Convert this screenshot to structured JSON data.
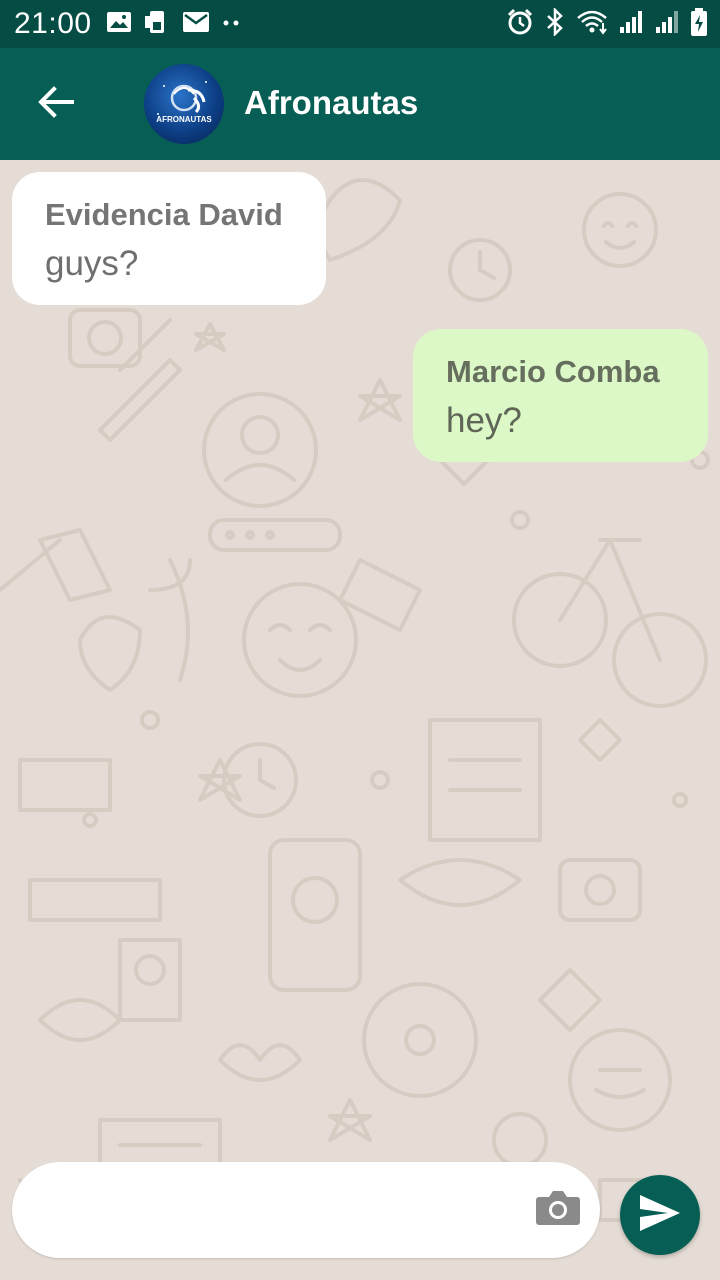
{
  "status_bar": {
    "time": "21:00",
    "left_icons": [
      "image-icon",
      "sim-card-icon",
      "mail-icon",
      "more-dots-icon"
    ],
    "right_icons": [
      "alarm-icon",
      "bluetooth-icon",
      "wifi-icon",
      "signal-icon",
      "signal-icon",
      "battery-charging-icon"
    ]
  },
  "header": {
    "contact_name": "Afronautas",
    "avatar_text": "AFRONAUTAS"
  },
  "messages": [
    {
      "sender": "Evidencia David",
      "text": "guys?",
      "direction": "incoming"
    },
    {
      "sender": "Marcio Comba",
      "text": "hey?",
      "direction": "outgoing"
    }
  ],
  "composer": {
    "input_value": "",
    "input_placeholder": ""
  },
  "colors": {
    "status_bar": "#054d44",
    "app_bar": "#075e54",
    "chat_background": "#e5ddd5",
    "incoming_bubble": "#ffffff",
    "outgoing_bubble": "#dcf8c6",
    "send_button": "#075e54"
  }
}
